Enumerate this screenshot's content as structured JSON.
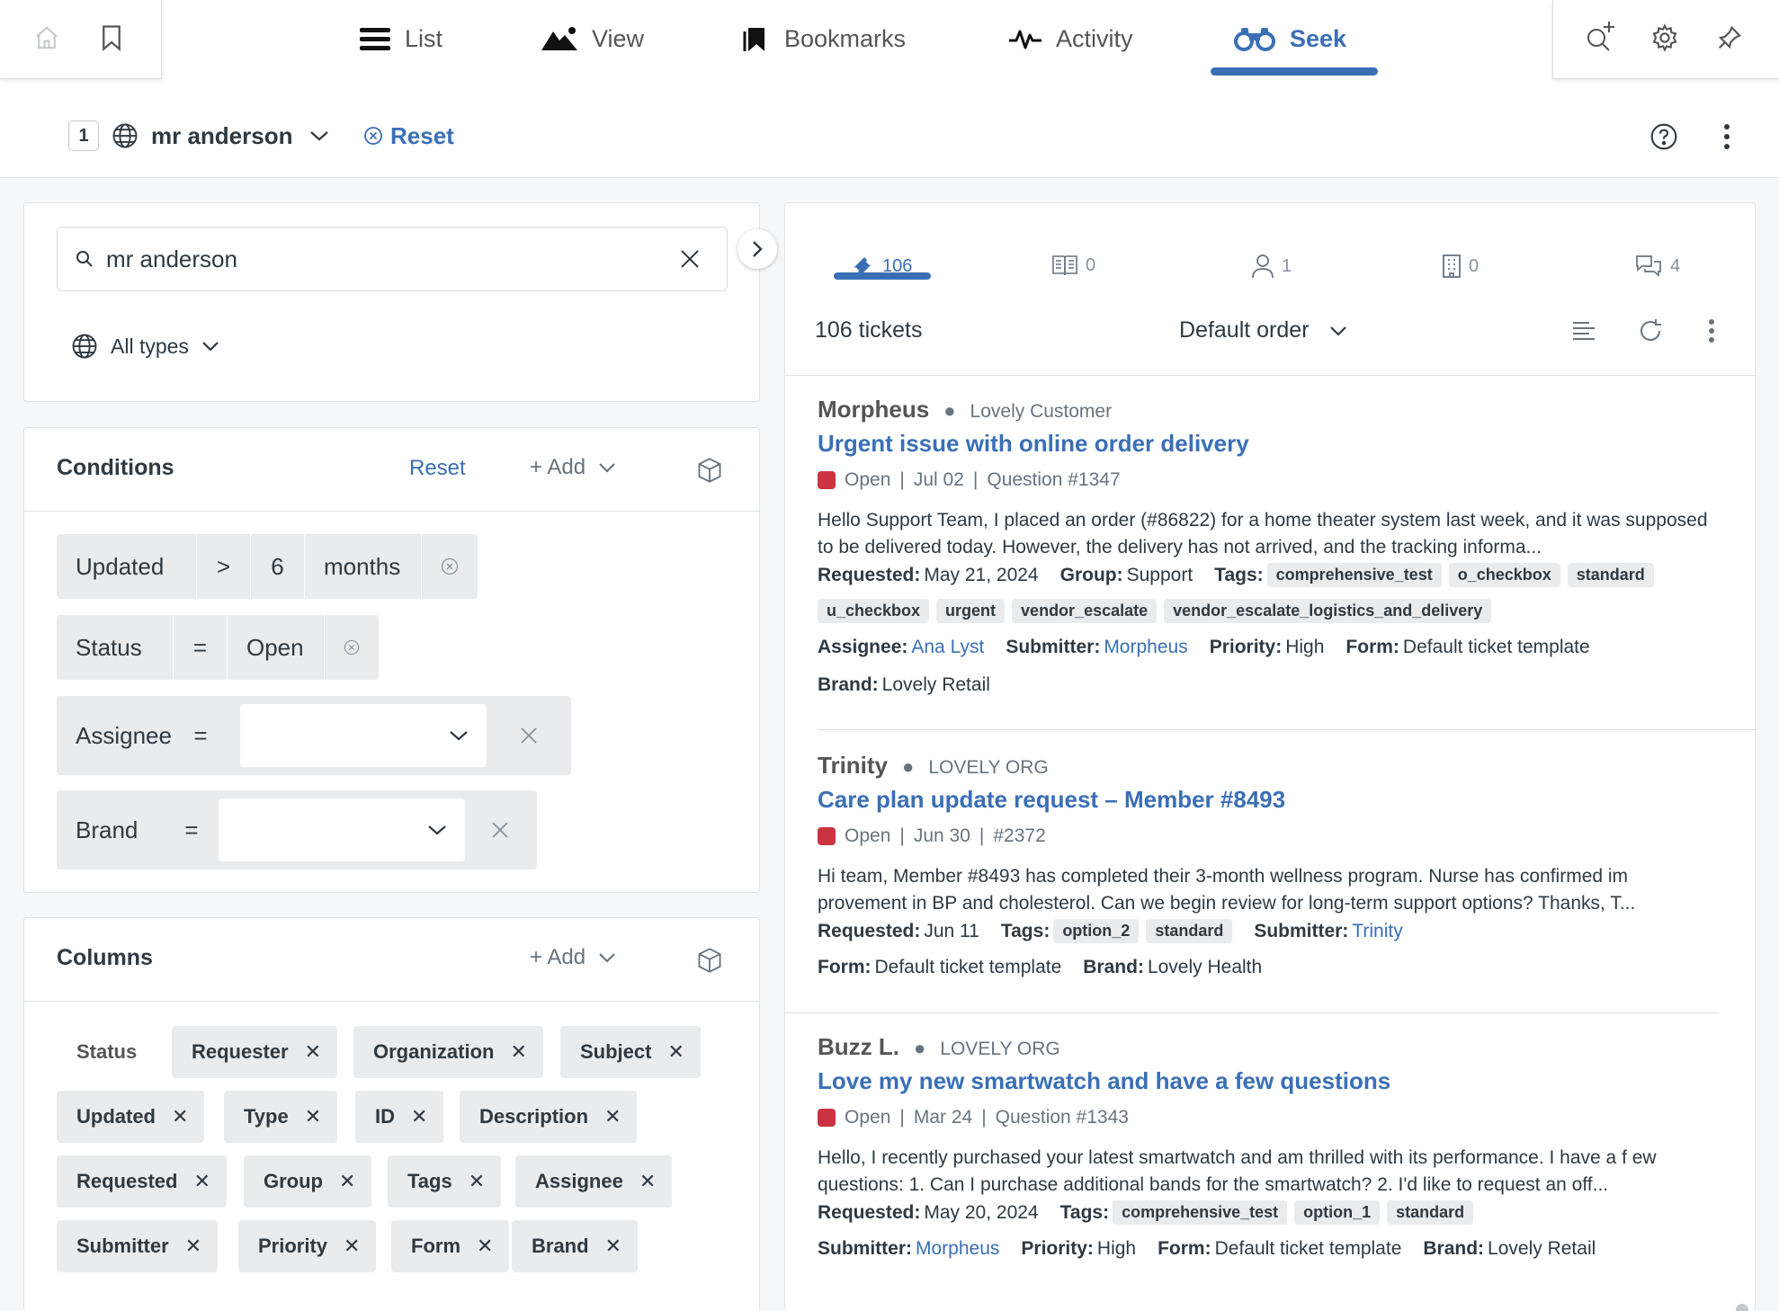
{
  "nav": {
    "tabs": [
      {
        "label": "List",
        "icon": "list-icon"
      },
      {
        "label": "View",
        "icon": "mountain-icon"
      },
      {
        "label": "Bookmarks",
        "icon": "bookmarks-icon"
      },
      {
        "label": "Activity",
        "icon": "activity-icon"
      },
      {
        "label": "Seek",
        "icon": "binoculars-icon"
      }
    ],
    "active_tab": "Seek",
    "accent_color": "#3a6fb6"
  },
  "subbar": {
    "count": "1",
    "view_name": "mr anderson",
    "reset_label": "Reset"
  },
  "search": {
    "value": "mr anderson",
    "type_filter": "All types"
  },
  "conditions": {
    "title": "Conditions",
    "reset_label": "Reset",
    "add_label": "+ Add",
    "rows": [
      {
        "field": "Updated",
        "op": ">",
        "value": "6",
        "unit": "months"
      },
      {
        "field": "Status",
        "op": "=",
        "value": "Open"
      },
      {
        "field": "Assignee",
        "op": "=",
        "value": ""
      },
      {
        "field": "Brand",
        "op": "=",
        "value": ""
      }
    ]
  },
  "columns": {
    "title": "Columns",
    "add_label": "+ Add",
    "items": [
      "Status",
      "Requester",
      "Organization",
      "Subject",
      "Updated",
      "Type",
      "ID",
      "Description",
      "Requested",
      "Group",
      "Tags",
      "Assignee",
      "Submitter",
      "Priority",
      "Form",
      "Brand"
    ]
  },
  "results": {
    "tabs": [
      {
        "count": "106",
        "icon": "ticket-icon"
      },
      {
        "count": "0",
        "icon": "article-icon"
      },
      {
        "count": "1",
        "icon": "user-icon"
      },
      {
        "count": "0",
        "icon": "building-icon"
      },
      {
        "count": "4",
        "icon": "chat-icon"
      }
    ],
    "summary": "106 tickets",
    "order": "Default order",
    "tickets": [
      {
        "requester": "Morpheus",
        "org": "Lovely Customer",
        "subject": "Urgent issue with online order delivery",
        "status": "Open",
        "date": "Jul 02",
        "ref": "Question #1347",
        "description": "Hello Support Team, I placed an order (#86822) for a home theater system last week, and it was supposed to be delivered today. However, the delivery has not arrived, and the tracking informa...",
        "requested_label": "Requested:",
        "requested": "May 21, 2024",
        "group_label": "Group:",
        "group": "Support",
        "tags_label": "Tags:",
        "tags_row1": [
          "comprehensive_test",
          "o_checkbox",
          "standard"
        ],
        "tags_row2": [
          "u_checkbox",
          "urgent",
          "vendor_escalate",
          "vendor_escalate_logistics_and_delivery"
        ],
        "assignee_label": "Assignee:",
        "assignee": "Ana Lyst",
        "submitter_label": "Submitter:",
        "submitter": "Morpheus",
        "priority_label": "Priority:",
        "priority": "High",
        "form_label": "Form:",
        "form": "Default ticket template",
        "brand_label": "Brand:",
        "brand": "Lovely Retail"
      },
      {
        "requester": "Trinity",
        "org": "LOVELY ORG",
        "subject": "Care plan update request – Member #8493",
        "status": "Open",
        "date": "Jun 30",
        "ref": "#2372",
        "description": "Hi team, Member #8493 has completed their 3-month wellness program. Nurse has confirmed im provement in BP and cholesterol. Can we begin review for long-term support options? Thanks, T...",
        "requested_label": "Requested:",
        "requested": "Jun 11",
        "tags_label": "Tags:",
        "tags": [
          "option_2",
          "standard"
        ],
        "submitter_label": "Submitter:",
        "submitter": "Trinity",
        "form_label": "Form:",
        "form": "Default ticket template",
        "brand_label": "Brand:",
        "brand": "Lovely Health"
      },
      {
        "requester": "Buzz L.",
        "org": "LOVELY ORG",
        "subject": "Love my new smartwatch and have a few questions",
        "status": "Open",
        "date": "Mar 24",
        "ref": "Question #1343",
        "description": "Hello, I recently purchased your latest smartwatch and am thrilled with its performance. I have a f ew questions: 1. Can I purchase additional bands for the smartwatch? 2. I'd like to request an off...",
        "requested_label": "Requested:",
        "requested": "May 20, 2024",
        "tags_label": "Tags:",
        "tags": [
          "comprehensive_test",
          "option_1",
          "standard"
        ],
        "submitter_label": "Submitter:",
        "submitter": "Morpheus",
        "priority_label": "Priority:",
        "priority": "High",
        "form_label": "Form:",
        "form": "Default ticket template",
        "brand_label": "Brand:",
        "brand": "Lovely Retail"
      }
    ],
    "status_color": "#cc3340"
  }
}
